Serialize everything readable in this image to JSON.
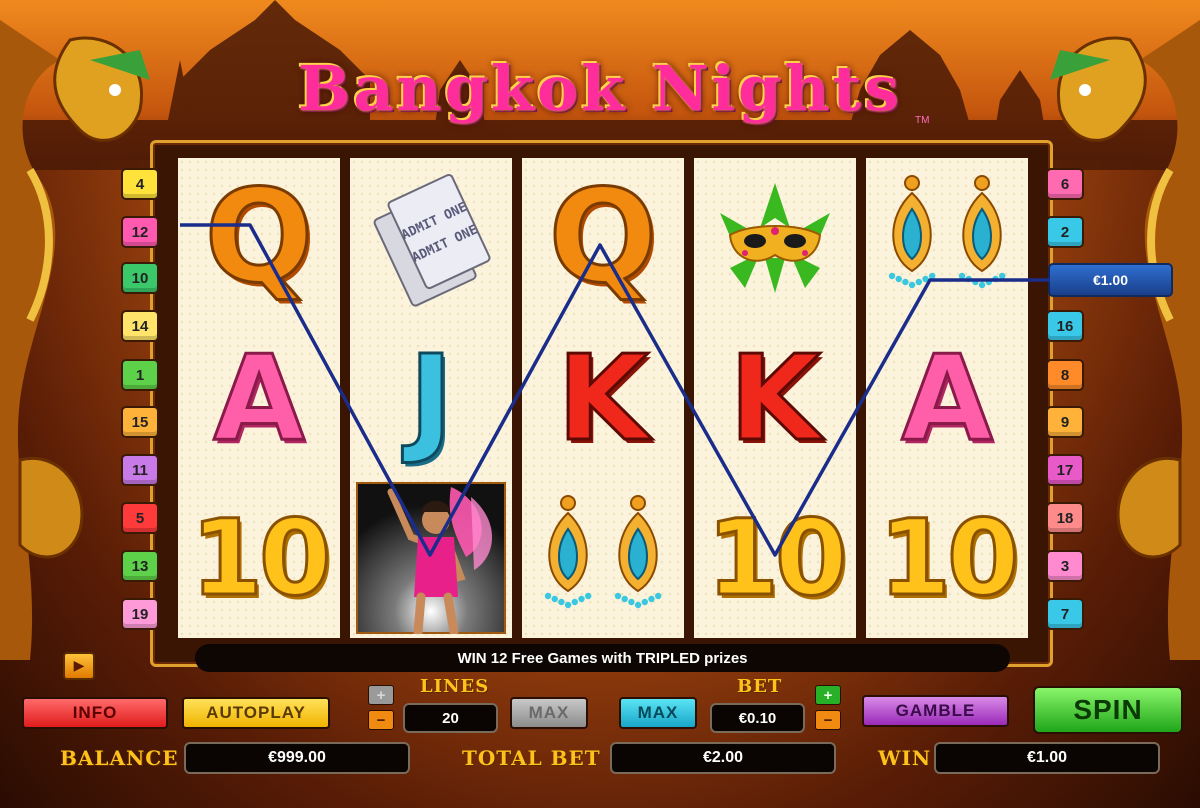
{
  "game": {
    "title": "Bangkok Nights",
    "trademark": "TM"
  },
  "reels": [
    [
      {
        "symbol": "Q",
        "icon": "q-symbol"
      },
      {
        "symbol": "A",
        "icon": "a-symbol"
      },
      {
        "symbol": "10",
        "icon": "ten-symbol"
      }
    ],
    [
      {
        "symbol": "",
        "icon": "admit-one-tickets-symbol"
      },
      {
        "symbol": "J",
        "icon": "j-symbol"
      },
      {
        "symbol": "",
        "icon": "dancer-symbol"
      }
    ],
    [
      {
        "symbol": "Q",
        "icon": "q-symbol"
      },
      {
        "symbol": "K",
        "icon": "k-symbol"
      },
      {
        "symbol": "",
        "icon": "earrings-symbol"
      }
    ],
    [
      {
        "symbol": "",
        "icon": "carnival-mask-symbol"
      },
      {
        "symbol": "K",
        "icon": "k-symbol"
      },
      {
        "symbol": "10",
        "icon": "ten-symbol"
      }
    ],
    [
      {
        "symbol": "",
        "icon": "earrings-symbol"
      },
      {
        "symbol": "A",
        "icon": "a-symbol"
      },
      {
        "symbol": "10",
        "icon": "ten-symbol"
      }
    ]
  ],
  "ticket_text": "ADMIT ONE",
  "line_markers_left": [
    "4",
    "12",
    "10",
    "14",
    "1",
    "15",
    "11",
    "5",
    "13",
    "19"
  ],
  "line_markers_right": [
    "6",
    "2",
    "16",
    "8",
    "9",
    "17",
    "18",
    "3",
    "7"
  ],
  "marker_colors": {
    "1": "#5ed14a",
    "2": "#3ac8e8",
    "3": "#ff8ad0",
    "4": "#ffe33a",
    "5": "#ff3a3a",
    "6": "#ff6ab0",
    "7": "#3ac8e8",
    "8": "#ff8a2a",
    "9": "#ffb23a",
    "10": "#3ac86a",
    "11": "#c87ae8",
    "12": "#ff5ab0",
    "13": "#5ed14a",
    "14": "#ffe36a",
    "15": "#ffb23a",
    "16": "#3ac8e8",
    "17": "#e85ac8",
    "18": "#ff8a8a",
    "19": "#ff9ad8"
  },
  "winning_line": {
    "line": "12",
    "amount": "€1.00"
  },
  "message": "WIN 12 Free Games with TRIPLED prizes",
  "controls": {
    "info": "INFO",
    "autoplay": "AUTOPLAY",
    "lines_label": "LINES",
    "lines_value": "20",
    "max_lines": "MAX",
    "max_bet": "MAX",
    "bet_label": "BET",
    "bet_value": "€0.10",
    "gamble": "GAMBLE",
    "spin": "SPIN",
    "plus": "+",
    "minus": "−",
    "arrow": "▶"
  },
  "status": {
    "balance_label": "BALANCE",
    "balance": "€999.00",
    "total_bet_label": "TOTAL BET",
    "total_bet": "€2.00",
    "win_label": "WIN",
    "win": "€1.00"
  }
}
